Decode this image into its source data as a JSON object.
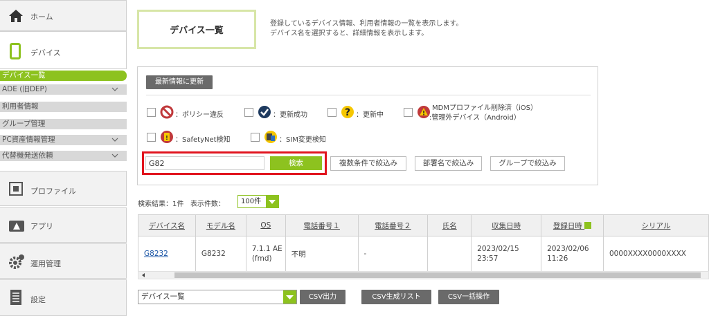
{
  "sidebar": {
    "home": "ホーム",
    "device": "デバイス",
    "subitems": [
      "デバイス一覧",
      "ADE (旧DEP)",
      "利用者情報",
      "グループ管理",
      "PC資産情報管理",
      "代替機発送依頼"
    ],
    "profile": "プロファイル",
    "app": "アプリ",
    "operation": "運用管理",
    "settings": "設定"
  },
  "header": {
    "title": "デバイス一覧",
    "desc1": "登録しているデバイス情報、利用者情報の一覧を表示します。",
    "desc2": "デバイス名を選択すると、詳細情報を表示します。"
  },
  "filters": {
    "refresh": "最新情報に更新",
    "legend": {
      "policy": "：ポリシー違反",
      "success": "：更新成功",
      "updating": "：更新中",
      "mdm1": "MDMプロファイル削除済（iOS）",
      "mdm2": "管理外デバイス（Android）",
      "safetynet": "：SafetyNet検知",
      "sim": "：SIM変更検知"
    },
    "search_value": "G82",
    "search_btn": "検索",
    "multi": "複数条件で絞込み",
    "dept": "部署名で絞込み",
    "group": "グループで絞込み"
  },
  "results": {
    "count": "検索結果：1件",
    "perpage_label": "表示件数：",
    "perpage_value": "100件"
  },
  "table": {
    "headers": [
      "デバイス名",
      "モデル名",
      "OS",
      "電話番号１",
      "電話番号２",
      "氏名",
      "収集日時",
      "登録日時",
      "シリアル"
    ],
    "row": {
      "device": "G8232",
      "model": "G8232",
      "os1": "7.1.1 AE",
      "os2": "(fmd)",
      "tel1": "不明",
      "tel2": "-",
      "name": "",
      "collected1": "2023/02/15",
      "collected2": "23:57",
      "registered1": "2023/02/06",
      "registered2": "11:26",
      "serial": "0000XXXX0000XXXX"
    }
  },
  "footer": {
    "select": "デバイス一覧",
    "csv_out": "CSV出力",
    "csv_list": "CSV生成リスト",
    "csv_bulk": "CSV一括操作"
  },
  "colors": {
    "accent": "#8dc21f",
    "highlight": "#e1141e"
  }
}
